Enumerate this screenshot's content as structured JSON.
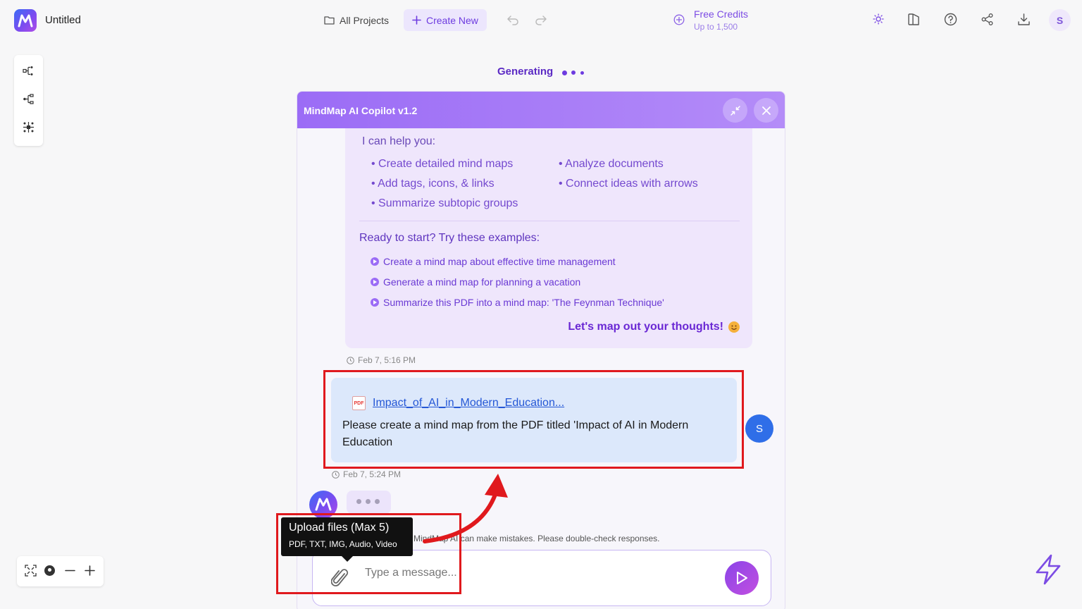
{
  "header": {
    "doc_title": "Untitled",
    "all_projects": "All Projects",
    "create_new": "Create New",
    "credits_title": "Free Credits",
    "credits_sub": "Up to 1,500",
    "user_initial": "S"
  },
  "status": {
    "generating": "Generating"
  },
  "copilot": {
    "title": "MindMap AI Copilot v1.2",
    "intro": "I can help you:",
    "capabilities": [
      "• Create detailed mind maps",
      "• Analyze documents",
      "• Add tags, icons, & links",
      "• Connect ideas with arrows",
      "• Summarize subtopic groups"
    ],
    "ready": "Ready to start? Try these examples:",
    "examples": [
      "Create a mind map about effective time management",
      "Generate a mind map for planning a vacation",
      "Summarize this PDF into a mind map: 'The Feynman Technique'"
    ],
    "cta": "Let's map out your thoughts!",
    "bot_time": "Feb 7, 5:16 PM",
    "user_file": "Impact_of_AI_in_Modern_Education...",
    "user_message": "Please create a mind map from the PDF titled 'Impact of AI in Modern Education",
    "user_time": "Feb 7, 5:24 PM",
    "user_initial": "S",
    "disclaimer": "MindMap AI can make mistakes. Please double-check responses.",
    "input_placeholder": "Type a message..."
  },
  "tooltip": {
    "title": "Upload files (Max 5)",
    "subtitle": "PDF, TXT, IMG, Audio, Video"
  },
  "colors": {
    "accent": "#6d3be0",
    "annotation_red": "#e0191d",
    "user_bubble": "#dce8fb",
    "bot_bubble": "#efe6fc"
  }
}
